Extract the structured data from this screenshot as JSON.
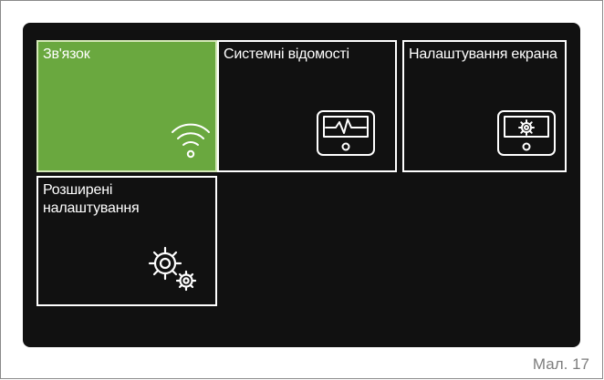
{
  "tiles": [
    {
      "label": "Зв'язок",
      "icon": "wifi-icon",
      "selected": true
    },
    {
      "label": "Системні відомості",
      "icon": "monitor-waveform-icon",
      "selected": false
    },
    {
      "label": "Налаштування екрана",
      "icon": "monitor-gear-icon",
      "selected": false
    },
    {
      "label": "Розширені налаштування",
      "icon": "gears-icon",
      "selected": false
    }
  ],
  "caption": "Мал. 17",
  "colors": {
    "screen_background": "#111111",
    "selected_tile": "#6aa83f",
    "tile_border": "#ffffff",
    "caption_text": "#7d7d7d"
  }
}
